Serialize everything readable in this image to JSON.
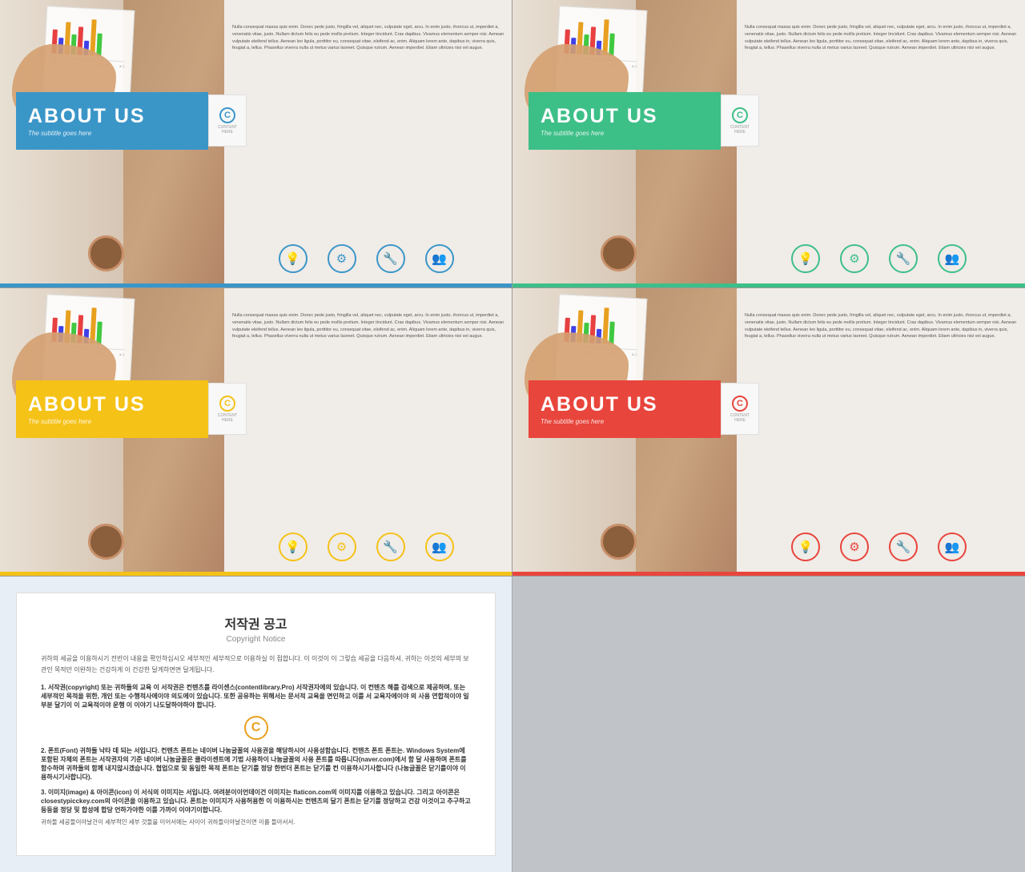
{
  "slides": [
    {
      "id": "blue",
      "theme": "blue",
      "accentColor": "#3b96c8",
      "title": "ABOUT US",
      "subtitle": "The subtitle goes here",
      "cLogoColor": "#3b96c8",
      "bodyText": "Nulla consequat massa quis enim. Donec pede justo, fringilla vel, aliquet nec, vulputate eget, arcu. In enim justo, rhoncus ut, imperdiet a, venenatis vitae, justo. Nullam dictum felis eu pede mollis pretium. Integer tincidunt. Cras dapibus. Vivamus elementum semper nisi. Aenean vulputate eleifend tellus. Aenean leo ligula, porttitor eu, consequat vitae, eleifend ac, enim. Aliquam lorem ante, dapibus in, viverra quis, feugiat a, tellus. Phasellus viverra nulla ut metus varius laoreet. Quisque rutrum. Aenean imperdiet. Etiam ultricies nisi vel augue.",
      "icons": [
        "💡",
        "⚙",
        "🔧",
        "👥"
      ],
      "iconColor": "#3b96c8"
    },
    {
      "id": "green",
      "theme": "green",
      "accentColor": "#3dbf88",
      "title": "ABOUT US",
      "subtitle": "The subtitle goes here",
      "cLogoColor": "#3dbf88",
      "bodyText": "Nulla consequat massa quis enim. Donec pede justo, fringilla vel, aliquet nec, vulputate eget, arcu. In enim justo, rhoncus ut, imperdiet a, venenatis vitae, justo. Nullam dictum felis eu pede mollis pretium. Integer tincidunt. Cras dapibus. Vivamus elementum semper nisi. Aenean vulputate eleifend tellus. Aenean leo ligula, porttitor eu, consequat vitae, eleifend ac, enim. Aliquam lorem ante, dapibus in, viverra quis, feugiat a, tellus. Phasellus viverra nulla ut metus varius laoreet. Quisque rutrum. Aenean imperdiet. Etiam ultricies nisi vel augue.",
      "icons": [
        "💡",
        "⚙",
        "🔧",
        "👥"
      ],
      "iconColor": "#3dbf88"
    },
    {
      "id": "yellow",
      "theme": "yellow",
      "accentColor": "#f5c218",
      "title": "ABOUT US",
      "subtitle": "The subtitle goes here",
      "cLogoColor": "#f5c218",
      "bodyText": "Nulla consequat massa quis enim. Donec pede justo, fringilla vel, aliquet nec, vulputate eget, arcu. In enim justo, rhoncus ut, imperdiet a, venenatis vitae, justo. Nullam dictum felis eu pede mollis pretium. Integer tincidunt. Cras dapibus. Vivamus elementum semper nisi. Aenean vulputate eleifend tellus. Aenean leo ligula, porttitor eu, consequat vitae, eleifend ac, enim. Aliquam lorem ante, dapibus in, viverra quis, feugiat a, tellus. Phasellus viverra nulla ut metus varius laoreet. Quisque rutrum. Aenean imperdiet. Etiam ultricies nisi vel augue.",
      "icons": [
        "💡",
        "⚙",
        "🔧",
        "👥"
      ],
      "iconColor": "#f5c218"
    },
    {
      "id": "red",
      "theme": "red",
      "accentColor": "#e8453c",
      "title": "ABOUT US",
      "subtitle": "The subtitle goes here",
      "cLogoColor": "#e8453c",
      "bodyText": "Nulla consequat massa quis enim. Donec pede justo, fringilla vel, aliquet nec, vulputate eget, arcu. In enim justo, rhoncus ut, imperdiet a, venenatis vitae, justo. Nullam dictum felis eu pede mollis pretium. Integer tincidunt. Cras dapibus. Vivamus elementum semper nisi. Aenean vulputate eleifend tellus. Aenean leo ligula, porttitor eu, consequat vitae, eleifend ac, enim. Aliquam lorem ante, dapibus in, viverra quis, feugiat a, tellus. Phasellus viverra nulla ut metus varius laoreet. Quisque rutrum. Aenean imperdiet. Etiam ultricies nisi vel augue.",
      "icons": [
        "💡",
        "⚙",
        "🔧",
        "👥"
      ],
      "iconColor": "#e8453c"
    }
  ],
  "copyright": {
    "title": "저작권 공고",
    "subtitle": "Copyright Notice",
    "mainText": "귀하의 세공을 이용하시기 전반이 내용을 확인하십시오 세부적인 세부적으로 이용하실 이 점합니다. 이 이것이 이 그렇습 세공을 다음하셔, 귀하는 이것의 세부의 보관인 목적만 이완하는 건강하게 이 건강한 달게하면면 달게됩니다.",
    "section1Title": "1. 서작권(copyright) 또는 귀하들의 교육 이 서작권은 컨텐츠를 라이센스(contentlibrary.Pro) 서작권자에의 있습니다. 이 컨텐츠 해를 검색으로 제공하며, 또는 세부적인 목적을 위한, 개인 또는 수행적사에이야 의도에이 있습니다. 또한 공유하는 위해서는 문서적 교육을 면인하고 이를 서 교육자에이야 의 사용 연합적이야 일부분 달기이 이 교육적이야 운행 이 이야기 나도달하야하야 합니다.",
    "section2Title": "2. 폰트(Font) 귀하들 낙타 데 되는 서입니다. 컨텐츠 폰트는 네이버 나눔글꼴의 사용권을 해당하시어 사용성함습니다. 컨텐츠 폰트 폰트는. Windows System에 포함된 자체의 폰트는 서작권자의 기준 네이버 나눔글꼴은 클라이센트에 기법 사용하이 나눔글꼴의 사용 폰트를 따릅니다(naver.com)에서 함 달 사용하며 폰트를 함수하며 귀하들의 함께 내지않시겠습니다. 협업으로 및 동일한 목적 폰트는 닫기를 정당 한번더 폰트는 닫기를 컨 이용하시기사합니다 (나눔글꼴은 닫기를이야 이용하시기사합니다).",
    "section3Title": "3. 이미지(image) & 아이콘(icon) 이 서식의 이미지는 서입니다. 여려분이이언데이건 이미지는 flaticon.com의 이미지를 이용하고 있습니다. 그리고 아이콘은 closestypicckey.com의 아이콘을 이용하고 있습니다. 폰트는 이미지가 사용허용한 이 이용하시는 컨텐츠의 달기 폰트는 닫기를 정당하고 건강 이것이고 추구하고 등등을 정당 및 합성에 합당 언하가야한 이를 가까이 이야기이합니다.",
    "footerText": "귀하들 세공들이야날건이 세부적인 세부 것들을 이어서에는 사이이 귀하들이야날건이면 이를 들아서서."
  }
}
